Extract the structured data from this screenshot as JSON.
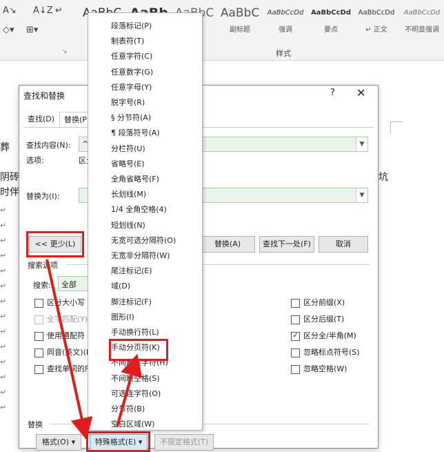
{
  "ribbon": {
    "icons": [
      "text-effects-icon",
      "sort-icon",
      "show-marks-icon",
      "shading-icon",
      "borders-icon"
    ],
    "styles": [
      {
        "preview": "AaBbC",
        "name": ""
      },
      {
        "preview": "AaBb",
        "name": ""
      },
      {
        "preview": "AaBbC",
        "name": ""
      },
      {
        "preview": "AaBbC",
        "name": "副标题"
      },
      {
        "preview": "AaBbCcDd",
        "name": "强调"
      },
      {
        "preview": "AaBbCcDd",
        "name": "要点"
      },
      {
        "preview": "AaBbCcDd",
        "name": "正文"
      },
      {
        "preview": "AaBbCcDd",
        "name": "不明显强调"
      }
    ],
    "group_label": "样式"
  },
  "document": {
    "lines": [
      "葬",
      "阴砖",
      "时伴"
    ],
    "right_char": "坑"
  },
  "dialog": {
    "title": "查找和替换",
    "help": "?",
    "close": "✕",
    "tabs": [
      "查找(D)",
      "替换(P)"
    ],
    "find_label": "查找内容(N):",
    "find_value": "^m",
    "options_label": "选项:",
    "options_value": "区分",
    "replace_label": "替换为(I):",
    "replace_value": "",
    "less_button": "<< 更少(L)",
    "replace_button": "替换(A)",
    "find_next_button": "查找下一处(F)",
    "cancel_button": "取消",
    "search_options_title": "搜索选项",
    "search_label": "搜索:",
    "search_value": "全部",
    "left_checks": [
      {
        "label": "区分大小写",
        "checked": false
      },
      {
        "label": "全字匹配(Y)",
        "checked": false
      },
      {
        "label": "使用通配符",
        "checked": false
      },
      {
        "label": "同音(英文)(K)",
        "checked": false
      },
      {
        "label": "查找单词的所",
        "checked": false
      }
    ],
    "right_checks": [
      {
        "label": "区分前缀(X)",
        "checked": false
      },
      {
        "label": "区分后缀(T)",
        "checked": false
      },
      {
        "label": "区分全/半角(M)",
        "checked": true
      },
      {
        "label": "忽略标点符号(S)",
        "checked": false
      },
      {
        "label": "忽略空格(W)",
        "checked": false
      }
    ],
    "replace_section": "替换",
    "format_button": "格式(O) ▾",
    "special_button": "特殊格式(E) ▾",
    "no_format_button": "不限定格式(T)"
  },
  "menu": {
    "items": [
      "段落标记(P)",
      "制表符(T)",
      "任意字符(C)",
      "任意数字(G)",
      "任意字母(Y)",
      "脱字号(R)",
      "§ 分节符(A)",
      "¶ 段落符号(A)",
      "分栏符(U)",
      "省略号(E)",
      "全角省略号(F)",
      "长划线(M)",
      "1/4 全角空格(4)",
      "短划线(N)",
      "无宽可选分隔符(O)",
      "无宽非分隔符(W)",
      "尾注标记(E)",
      "域(D)",
      "脚注标记(F)",
      "图形(I)",
      "手动换行符(L)",
      "手动分页符(K)",
      "不间断连字符(H)",
      "不间断空格(S)",
      "可选连字符(O)",
      "分节符(B)",
      "空白区域(W)"
    ],
    "highlighted": "手动分页符(K)"
  },
  "annotation_color": "#e31b1b"
}
